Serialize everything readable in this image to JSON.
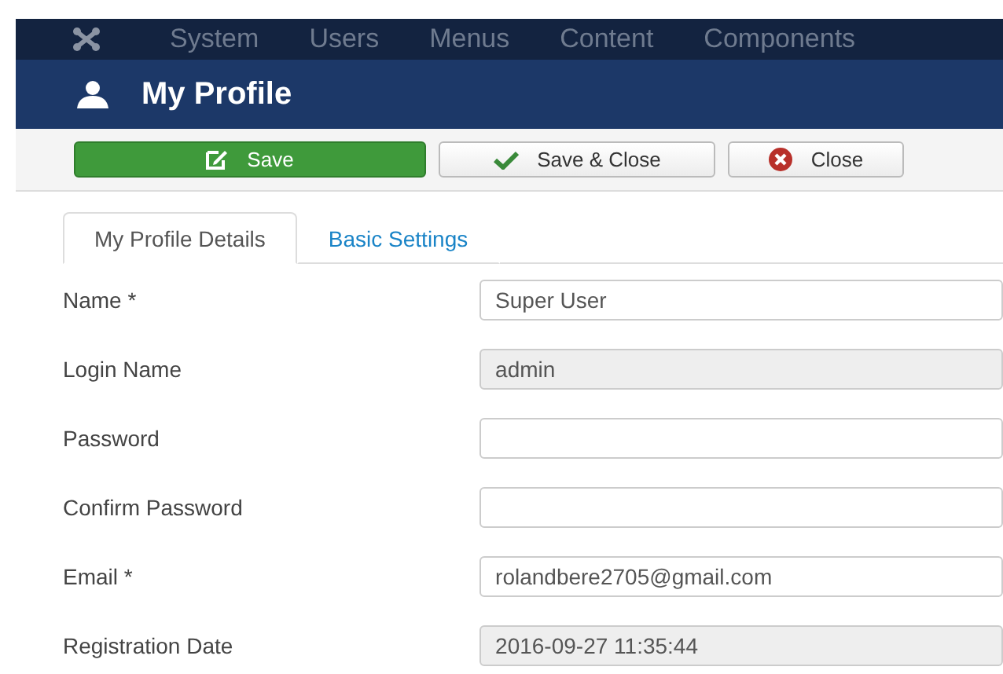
{
  "nav": {
    "items": [
      "System",
      "Users",
      "Menus",
      "Content",
      "Components"
    ]
  },
  "header": {
    "title": "My Profile"
  },
  "toolbar": {
    "buttons": [
      {
        "label": "Save",
        "kind": "save"
      },
      {
        "label": "Save & Close",
        "kind": "save-close"
      },
      {
        "label": "Close",
        "kind": "close"
      }
    ]
  },
  "tabs": [
    {
      "label": "My Profile Details",
      "selected": true
    },
    {
      "label": "Basic Settings",
      "selected": false
    }
  ],
  "fields": [
    {
      "label": "Name *",
      "value": "Super User",
      "disabled": false
    },
    {
      "label": "Login Name",
      "value": "admin",
      "disabled": true
    },
    {
      "label": "Password",
      "disabled": false
    },
    {
      "label": "Confirm Password",
      "disabled": false
    },
    {
      "label": "Email *",
      "value": "rolandbere2705@gmail.com",
      "disabled": false
    },
    {
      "label": "Registration Date",
      "value": "2016-09-27 11:35:44",
      "disabled": true
    }
  ]
}
